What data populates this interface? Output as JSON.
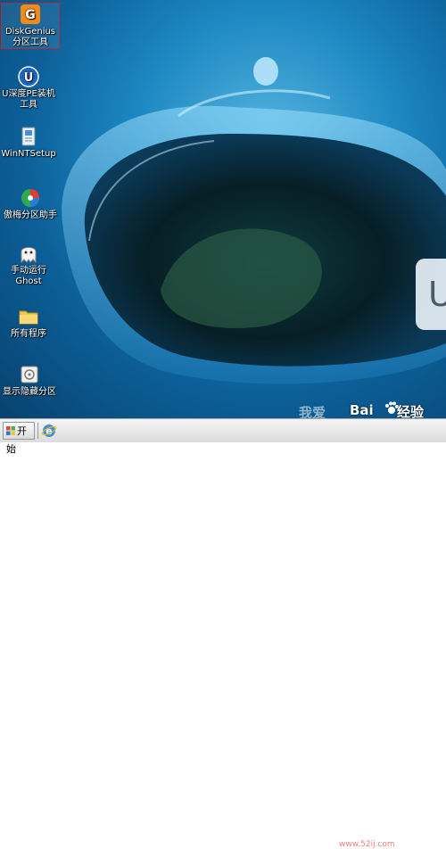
{
  "desktop": {
    "icons": [
      {
        "label": "DiskGenius 分区工具",
        "icon": "diskgenius-icon",
        "selected": true
      },
      {
        "label": "U深度PE装机工具",
        "icon": "udeepin-pe-installer-icon"
      },
      {
        "label": "WinNTSetup",
        "icon": "winntsetup-icon"
      },
      {
        "label": "傲梅分区助手",
        "icon": "aomei-partition-assistant-icon"
      },
      {
        "label": "手动运行Ghost",
        "icon": "ghost-icon"
      },
      {
        "label": "所有程序",
        "icon": "folder-icon"
      },
      {
        "label": "显示隐藏分区",
        "icon": "show-hidden-partition-icon"
      }
    ],
    "logo_letter": "U"
  },
  "watermark": {
    "left_text": "我爱",
    "site": "www.52ij.com",
    "brand_text": "Bai",
    "brand_suffix": "经验"
  },
  "taskbar": {
    "start_label": "开始"
  },
  "colors": {
    "selection_border": "#b0303a",
    "desktop_blue": "#1d88c2"
  }
}
